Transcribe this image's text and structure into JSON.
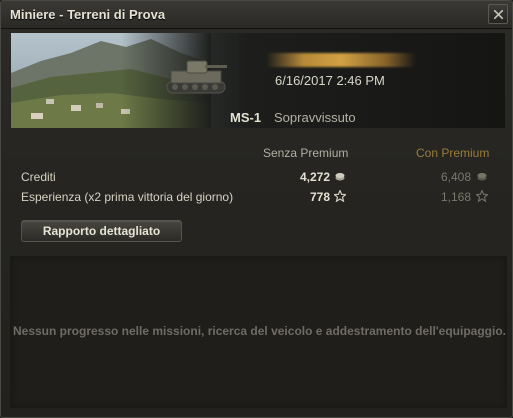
{
  "window": {
    "title": "Miniere - Terreni di Prova"
  },
  "battle": {
    "date": "6/16/2017 2:46 PM",
    "vehicle": "MS-1",
    "status": "Sopravvissuto"
  },
  "columns": {
    "standard": "Senza Premium",
    "premium": "Con Premium"
  },
  "rows": [
    {
      "label": "Crediti",
      "standard": "4,272",
      "premium": "6,408",
      "icon": "credits-icon"
    },
    {
      "label": "Esperienza  (x2 prima vittoria del giorno)",
      "standard": "778",
      "premium": "1,168",
      "icon": "xp-star-icon"
    }
  ],
  "buttons": {
    "detail": "Rapporto dettagliato"
  },
  "progress": {
    "message": "Nessun progresso nelle missioni, ricerca del veicolo e addestramento dell'equipaggio."
  },
  "colors": {
    "premium_accent": "#9c7b3c",
    "background": "#262521"
  }
}
